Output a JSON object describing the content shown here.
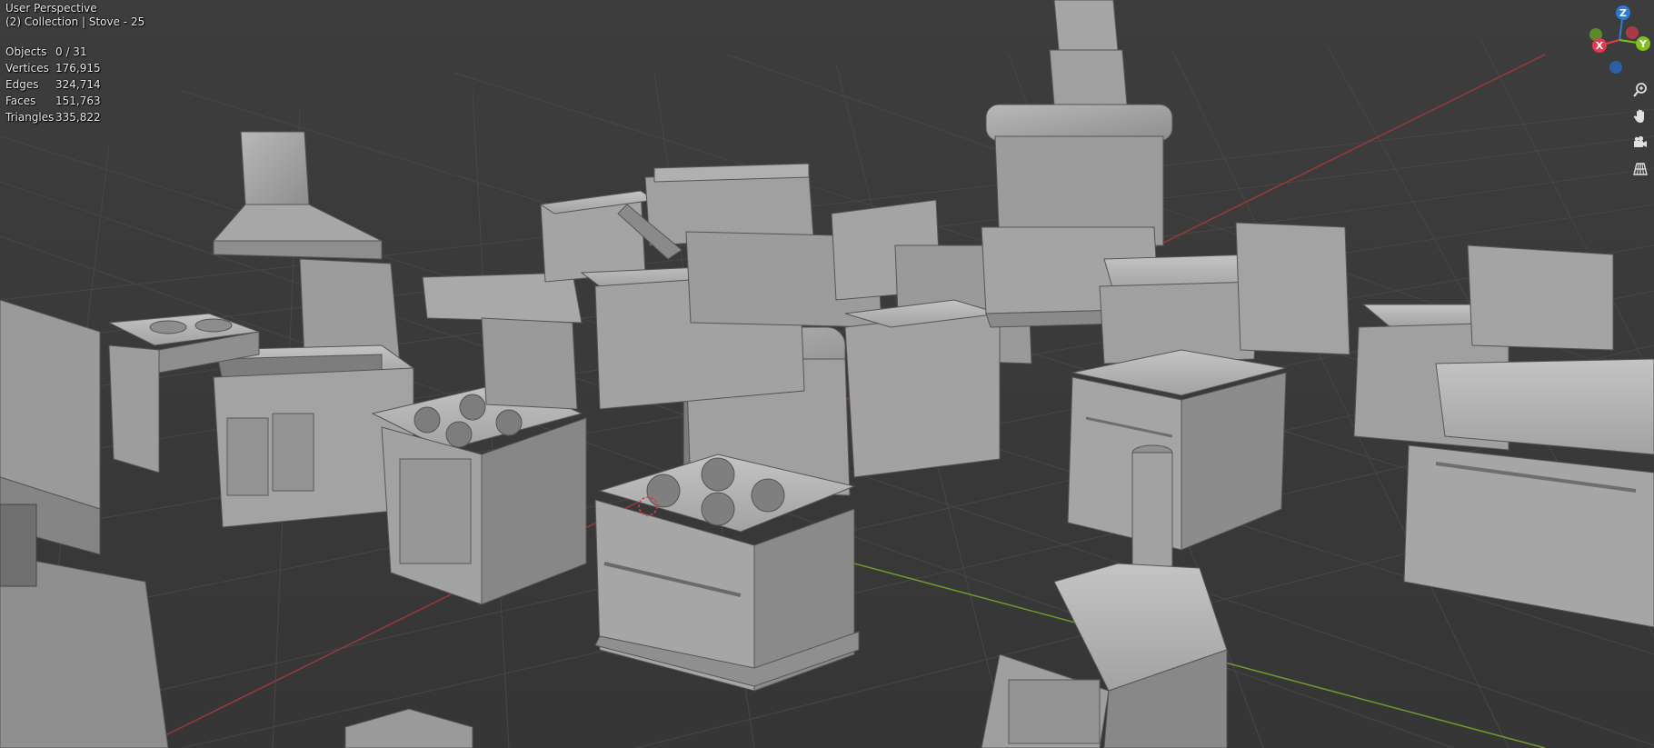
{
  "viewport": {
    "view_name": "User Perspective",
    "collection_line": "(2) Collection | Stove - 25"
  },
  "statistics": [
    {
      "label": "Objects",
      "value": "0 / 31"
    },
    {
      "label": "Vertices",
      "value": "176,915"
    },
    {
      "label": "Edges",
      "value": "324,714"
    },
    {
      "label": "Faces",
      "value": "151,763"
    },
    {
      "label": "Triangles",
      "value": "335,822"
    }
  ],
  "gizmo": {
    "axes": [
      {
        "name": "Z",
        "color": "#2b7cd6"
      },
      {
        "name": "Y",
        "color": "#7fbf1f"
      },
      {
        "name": "X",
        "color": "#e53950"
      }
    ],
    "negative_axis_colors": {
      "x": "#a83a4a",
      "y": "#5a8a2a",
      "z": "#2c5fa3"
    }
  },
  "tools": [
    {
      "name": "zoom-icon"
    },
    {
      "name": "pan-hand-icon"
    },
    {
      "name": "camera-icon"
    },
    {
      "name": "grid-ortho-icon"
    }
  ],
  "colors": {
    "background": "#3b3b3b",
    "grid": "#454545",
    "x_axis": "#b03a3a",
    "y_axis": "#6a9a2a",
    "model": "#a6a6a6"
  }
}
